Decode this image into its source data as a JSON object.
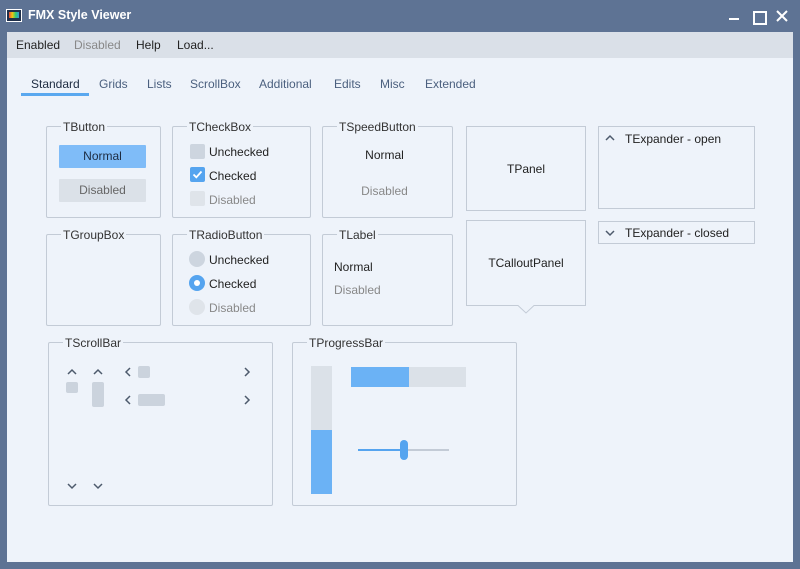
{
  "window": {
    "title": "FMX Style Viewer"
  },
  "menu": {
    "items": [
      "Enabled",
      "Disabled",
      "Help",
      "Load..."
    ]
  },
  "tabs": [
    "Standard",
    "Grids",
    "Lists",
    "ScrollBox",
    "Additional",
    "Edits",
    "Misc",
    "Extended"
  ],
  "active_tab": "Standard",
  "tbutton": {
    "title": "TButton",
    "normal": "Normal",
    "disabled": "Disabled"
  },
  "tcheckbox": {
    "title": "TCheckBox",
    "items": [
      "Unchecked",
      "Checked",
      "Disabled"
    ]
  },
  "tspeedbutton": {
    "title": "TSpeedButton",
    "normal": "Normal",
    "disabled": "Disabled"
  },
  "tpanel": {
    "label": "TPanel"
  },
  "texpander_open": {
    "label": "TExpander - open"
  },
  "texpander_closed": {
    "label": "TExpander - closed"
  },
  "tgroupbox": {
    "title": "TGroupBox"
  },
  "tradiobutton": {
    "title": "TRadioButton",
    "items": [
      "Unchecked",
      "Checked",
      "Disabled"
    ]
  },
  "tlabel": {
    "title": "TLabel",
    "normal": "Normal",
    "disabled": "Disabled"
  },
  "tcalloutpanel": {
    "label": "TCalloutPanel"
  },
  "tscrollbar": {
    "title": "TScrollBar"
  },
  "tprogressbar": {
    "title": "TProgressBar",
    "horizontal_progress": 0.5,
    "vertical_progress": 0.5,
    "trackbar_value": 0.5
  },
  "colors": {
    "accent": "#55a4ef",
    "titlebar": "#5e7394",
    "background": "#eef3fa"
  }
}
